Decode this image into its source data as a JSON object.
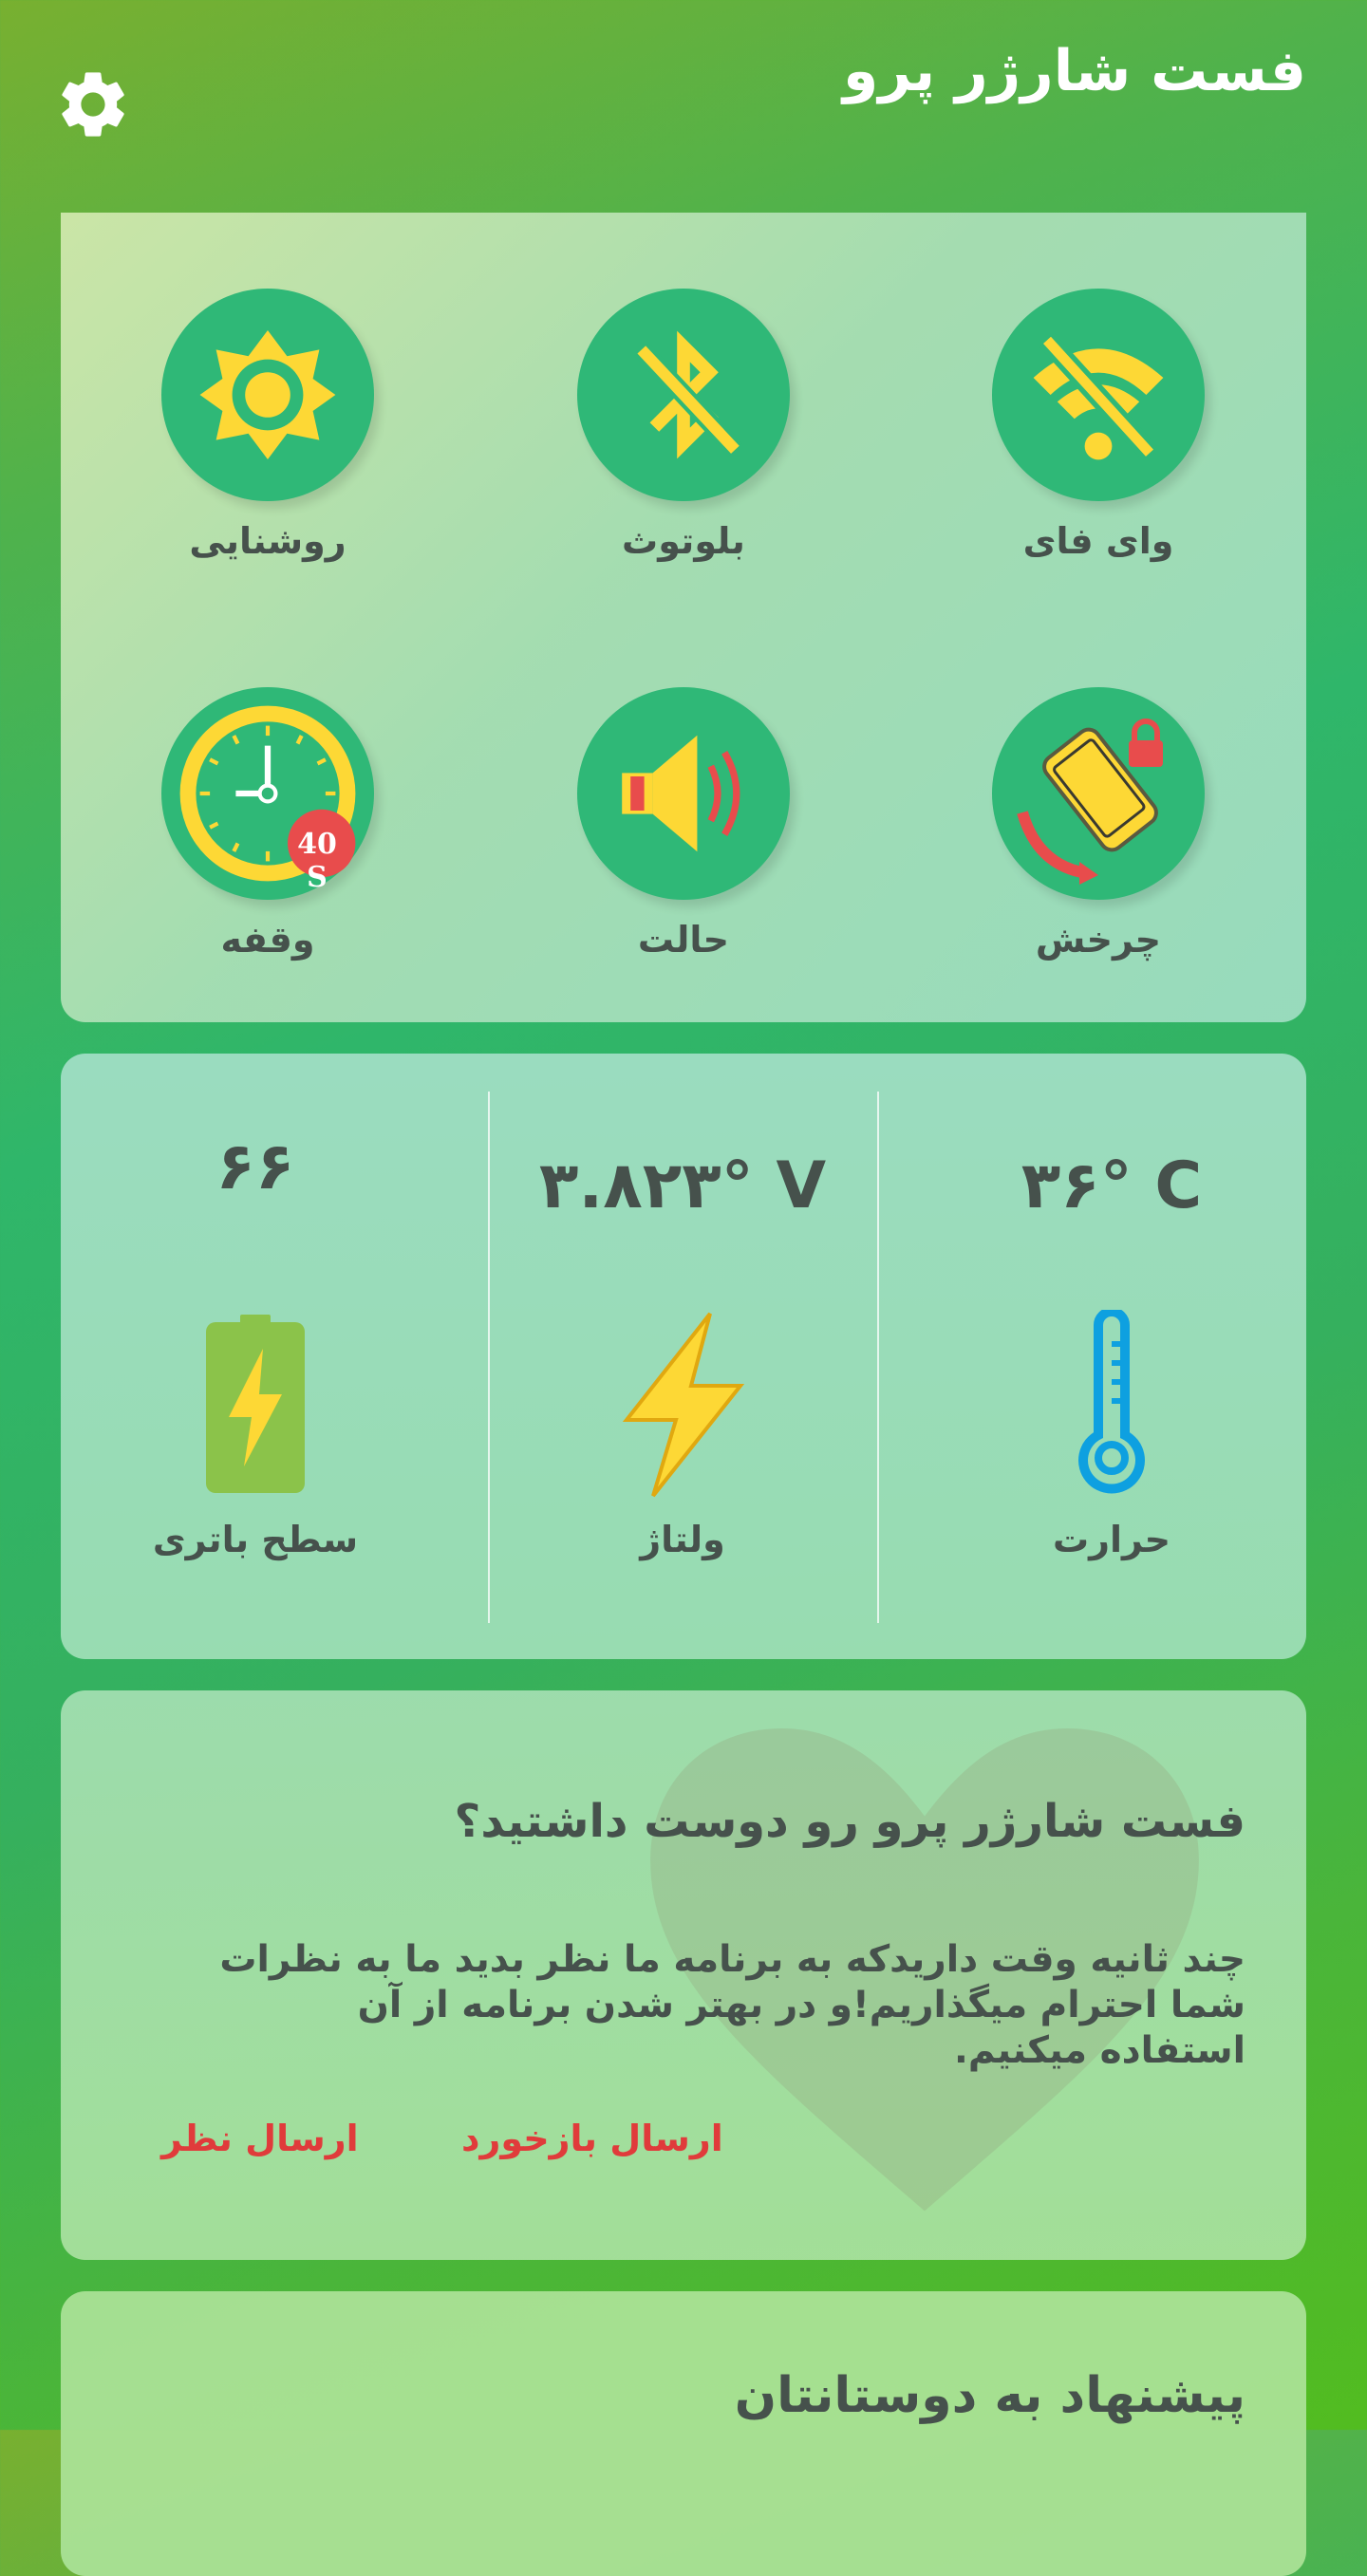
{
  "header": {
    "title": "فست شارژر پرو",
    "settings_icon": "gear-icon"
  },
  "toggles": [
    {
      "label": "وای فای",
      "icon": "wifi-off-icon"
    },
    {
      "label": "بلوتوث",
      "icon": "bluetooth-off-icon"
    },
    {
      "label": "روشنایی",
      "icon": "brightness-icon"
    },
    {
      "label": "چرخش",
      "icon": "screen-rotation-lock-icon"
    },
    {
      "label": "حالت",
      "icon": "sound-mode-icon"
    },
    {
      "label": "وقفه",
      "icon": "screen-timeout-icon",
      "badge": "40 S"
    }
  ],
  "stats": {
    "temperature": {
      "value": "۳۶° C",
      "label": "حرارت",
      "icon": "thermometer-icon"
    },
    "voltage": {
      "value": "۳.۸۲۳° V",
      "label": "ولتاژ",
      "icon": "lightning-icon"
    },
    "battery": {
      "value": "۶۶",
      "label": "سطح باتری",
      "icon": "battery-charging-icon"
    }
  },
  "rate": {
    "title": "فست شارژر پرو رو دوست داشتید؟",
    "body": "چند ثانیه وقت داریدکه به برنامه ما نظر بدید ما به نظرات شما احترام میگذاریم!و در بهتر شدن برنامه از آن استفاده میکنیم.",
    "feedback_button": "ارسال بازخورد",
    "review_button": "ارسال نظر"
  },
  "share": {
    "title": "پیشنهاد به دوستانتان"
  },
  "colors": {
    "accent_yellow": "#fdd835",
    "toggle_bg": "#2fb877",
    "button_red": "#e03b3b"
  }
}
